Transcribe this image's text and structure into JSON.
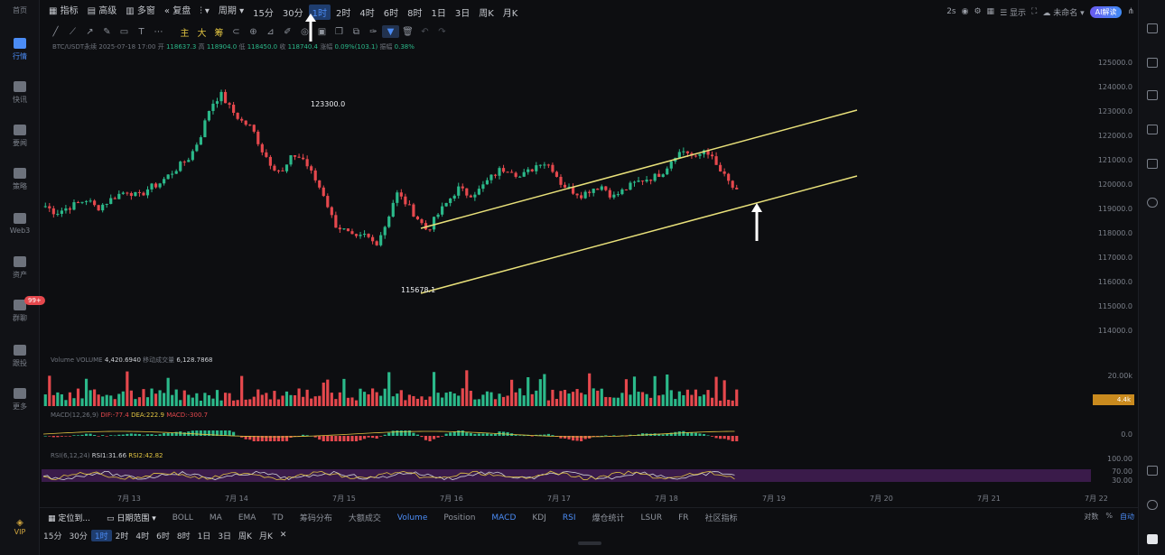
{
  "sidebar": {
    "items": [
      {
        "label": "首页"
      },
      {
        "label": "行情"
      },
      {
        "label": "快讯"
      },
      {
        "label": "要闻"
      },
      {
        "label": "策略"
      },
      {
        "label": "Web3"
      },
      {
        "label": "资产"
      },
      {
        "label": "群聊"
      },
      {
        "label": "跟投"
      },
      {
        "label": "更多"
      }
    ],
    "badge": "99+",
    "vip_label": "VIP"
  },
  "toolbar": {
    "indicators": "指标",
    "advanced": "高级",
    "multi_chart": "多窗",
    "replay": "复盘",
    "period": "周期",
    "timeframes": [
      "15分",
      "30分",
      "1时",
      "2时",
      "4时",
      "6时",
      "8时",
      "1日",
      "3日",
      "周K",
      "月K"
    ],
    "active_timeframe": "1时",
    "interval_s": "2s",
    "display": "显示",
    "unnamed": "未命名",
    "ai_button": "AI解读",
    "drawing_main": "主",
    "drawing_big": "大",
    "drawing_chip": "筹"
  },
  "ohlc_line": {
    "symbol": "BTC/USDT永续",
    "time": "2025-07-18 17:00",
    "open_label": "开",
    "open": "118637.3",
    "high_label": "高",
    "high": "118904.0",
    "low_label": "低",
    "low": "118450.0",
    "close_label": "收",
    "close": "118740.4",
    "change_label": "涨幅",
    "change": "0.09%(103.1)",
    "amp_label": "振幅",
    "amp": "0.38%"
  },
  "chart_data": {
    "type": "candlestick",
    "annotations": {
      "high": "123300.0",
      "low": "115678.1"
    },
    "y_ticks": [
      "125000.0",
      "124000.0",
      "123000.0",
      "122000.0",
      "121000.0",
      "120000.0",
      "119000.0",
      "118000.0",
      "117000.0",
      "116000.0",
      "115000.0",
      "114000.0"
    ],
    "ylim": [
      113700,
      125400
    ],
    "x_ticks": [
      "7月 13",
      "7月 14",
      "7月 15",
      "7月 16",
      "7月 17",
      "7月 18",
      "7月 19",
      "7月 20",
      "7月 21",
      "7月 22"
    ],
    "close_path": [
      118000,
      117700,
      117900,
      118100,
      118300,
      117900,
      118200,
      118500,
      118700,
      118400,
      118800,
      119000,
      119400,
      119800,
      120200,
      121100,
      122500,
      123000,
      122300,
      121800,
      121500,
      120500,
      119800,
      119500,
      120300,
      120100,
      119300,
      118500,
      117200,
      116900,
      116500,
      116700,
      116300,
      117200,
      118600,
      118100,
      117500,
      116900,
      117600,
      118200,
      118800,
      118500,
      118700,
      119200,
      119600,
      119700,
      119300,
      119600,
      120000,
      119800,
      119000,
      118700,
      118500,
      118800,
      118900,
      118400,
      118700,
      119000,
      119200,
      119300,
      119600,
      120300,
      120500,
      120100,
      120600,
      119800,
      119200,
      118600
    ]
  },
  "volume": {
    "label": "Volume",
    "title": "VOLUME",
    "value": "4,420.6940",
    "ma_label": "移动成交量",
    "ma": "6,128.7868",
    "tick": "20.00k",
    "current": "4.4k"
  },
  "macd": {
    "label": "MACD(12,26,9)",
    "dif": "DIF:-77.4",
    "dea": "DEA:222.9",
    "macd": "MACD:-300.7",
    "tick": "0.0"
  },
  "rsi": {
    "label": "RSI(6,12,24)",
    "rsi1": "RSI1:31.66",
    "rsi2": "RSI2:42.82",
    "ticks": [
      "100.00",
      "70.00",
      "30.00"
    ]
  },
  "bottom_bar": {
    "locate": "定位到...",
    "date_range": "日期范围",
    "tools": [
      "BOLL",
      "MA",
      "EMA",
      "TD",
      "筹码分布",
      "大额成交",
      "Volume",
      "Position",
      "MACD",
      "KDJ",
      "RSI",
      "爆仓统计",
      "LSUR",
      "FR",
      "社区指标"
    ],
    "active_tools": [
      "Volume",
      "MACD",
      "RSI"
    ],
    "right": [
      "对数",
      "%",
      "自动"
    ],
    "timeframes": [
      "15分",
      "30分",
      "1时",
      "2时",
      "4时",
      "6时",
      "8时",
      "1日",
      "3日",
      "周K",
      "月K"
    ],
    "active_timeframe": "1时"
  },
  "colors": {
    "up": "#2bb98a",
    "down": "#e5484d",
    "trendline": "#e8e07a",
    "accent": "#4b8cf5",
    "bg": "#0d0e11"
  }
}
